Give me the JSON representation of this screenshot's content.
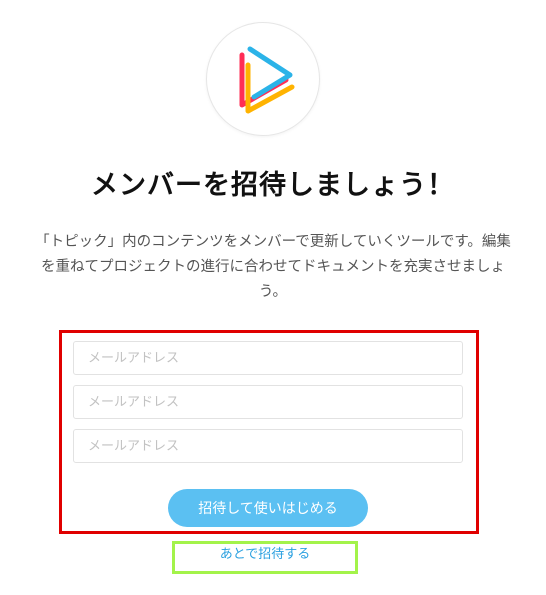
{
  "logo": {
    "icon": "play-triangle-logo",
    "colors": [
      "#ff2d55",
      "#ffb300",
      "#2bb3e8"
    ]
  },
  "title": "メンバーを招待しましょう！",
  "description": "「トピック」内のコンテンツをメンバーで更新していくツールです。編集を重ねてプロジェクトの進行に合わせてドキュメントを充実させましょう。",
  "form": {
    "email_fields": [
      {
        "placeholder": "メールアドレス",
        "value": ""
      },
      {
        "placeholder": "メールアドレス",
        "value": ""
      },
      {
        "placeholder": "メールアドレス",
        "value": ""
      }
    ],
    "submit_label": "招待して使いはじめる"
  },
  "later_link": "あとで招待する",
  "colors": {
    "accent": "#5bc0f2",
    "link": "#2aa0e0",
    "highlight_red": "#e00000",
    "highlight_green": "#a3f34a"
  }
}
